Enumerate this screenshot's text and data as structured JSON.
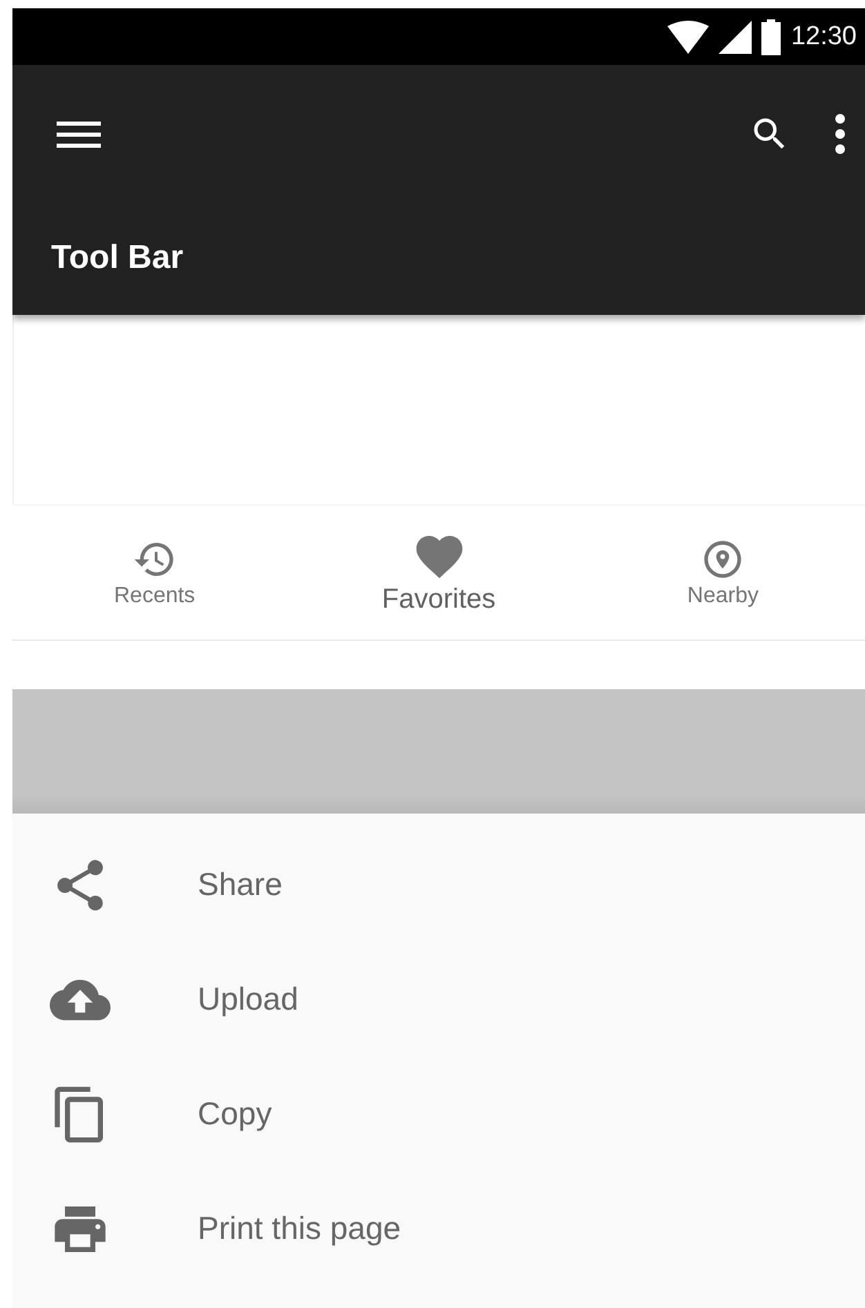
{
  "status_bar": {
    "time": "12:30"
  },
  "toolbar": {
    "title": "Tool Bar"
  },
  "bottom_nav": [
    {
      "label": "Recents",
      "kind": "history",
      "selected": false
    },
    {
      "label": "Favorites",
      "kind": "heart",
      "selected": true
    },
    {
      "label": "Nearby",
      "kind": "place",
      "selected": false
    }
  ],
  "bottom_sheet": {
    "items": [
      {
        "label": "Share",
        "kind": "share"
      },
      {
        "label": "Upload",
        "kind": "upload"
      },
      {
        "label": "Copy",
        "kind": "copy"
      },
      {
        "label": "Print this page",
        "kind": "print"
      }
    ]
  }
}
